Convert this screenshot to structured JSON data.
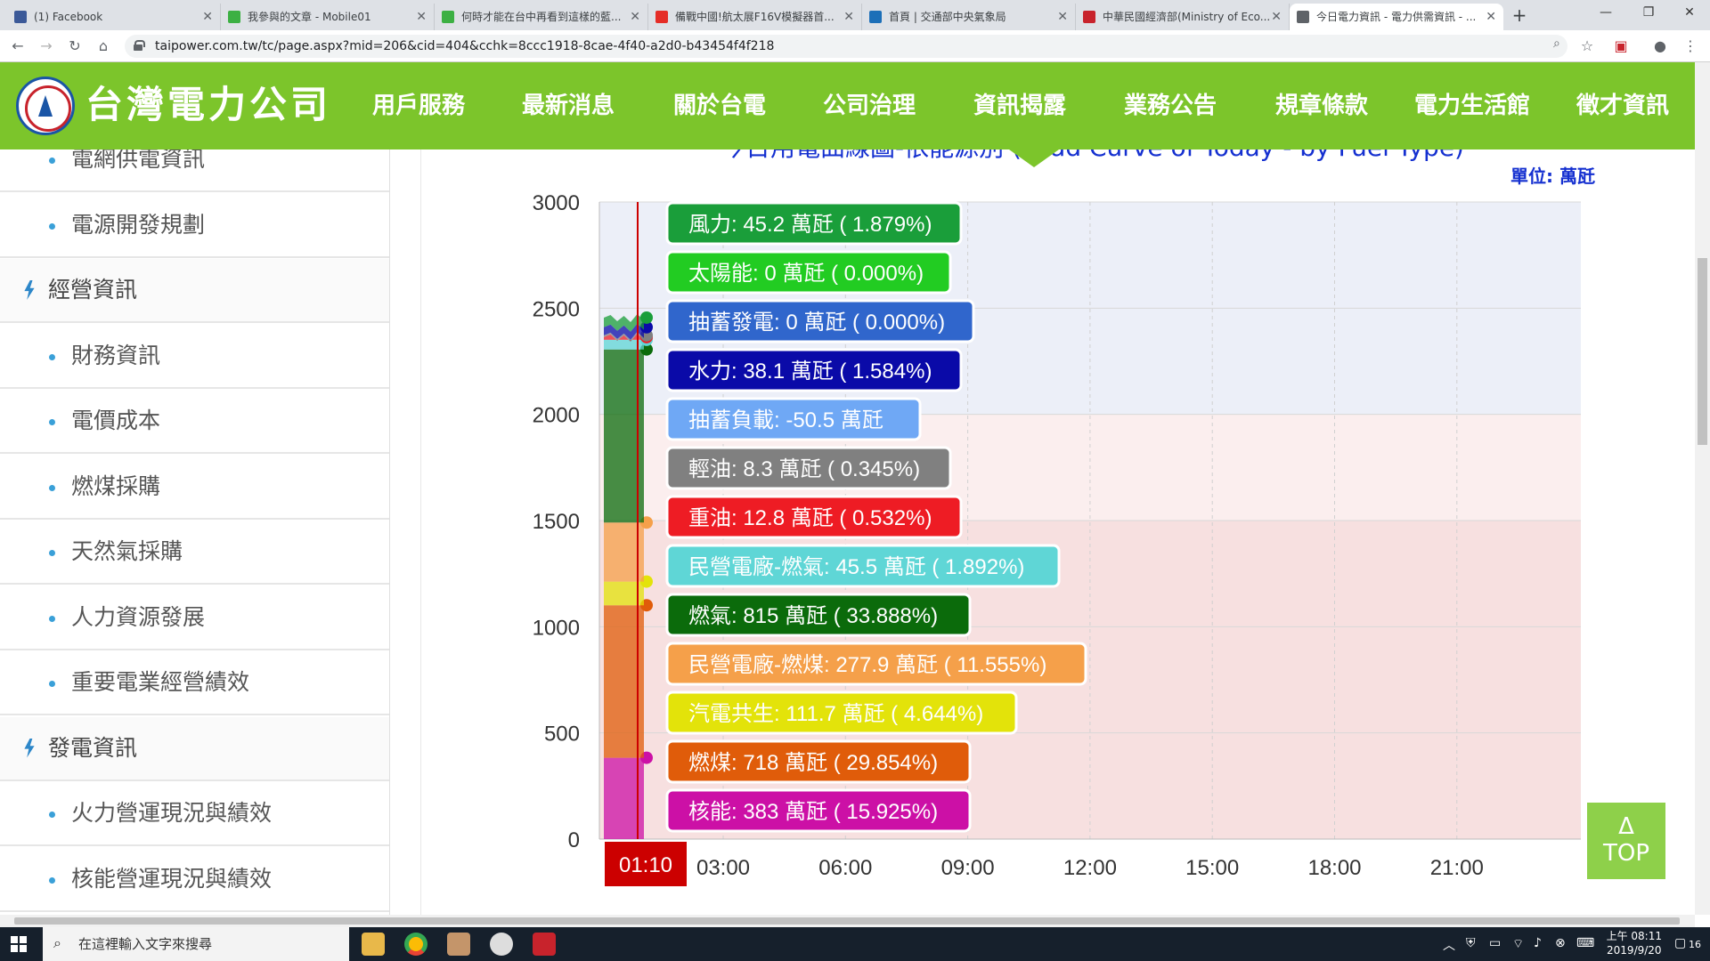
{
  "browser": {
    "tabs": [
      {
        "title": "(1) Facebook",
        "color": "#3b5998"
      },
      {
        "title": "我參與的文章 - Mobile01",
        "color": "#3cb043"
      },
      {
        "title": "何時才能在台中再看到這樣的藍...",
        "color": "#3cb043"
      },
      {
        "title": "備戰中國!航太展F16V模擬器首...",
        "color": "#e52d27"
      },
      {
        "title": "首頁 | 交通部中央氣象局",
        "color": "#1c6fb8"
      },
      {
        "title": "中華民國經濟部(Ministry of Eco...",
        "color": "#c8232c"
      },
      {
        "title": "今日電力資訊 - 電力供需資訊 - ...",
        "color": "#5f6368"
      }
    ],
    "url": "taipower.com.tw/tc/page.aspx?mid=206&cid=404&cchk=8ccc1918-8cae-4f40-a2d0-b43454f4f218"
  },
  "site": {
    "brand": "台灣電力公司",
    "nav": [
      "用戶服務",
      "最新消息",
      "關於台電",
      "公司治理",
      "資訊揭露",
      "業務公告",
      "規章條款",
      "電力生活館",
      "徵才資訊"
    ]
  },
  "sidebar": {
    "items": [
      {
        "label": "電網供電資訊",
        "type": "sub"
      },
      {
        "label": "電源開發規劃",
        "type": "sub"
      },
      {
        "label": "經營資訊",
        "type": "head"
      },
      {
        "label": "財務資訊",
        "type": "sub"
      },
      {
        "label": "電價成本",
        "type": "sub"
      },
      {
        "label": "燃煤採購",
        "type": "sub"
      },
      {
        "label": "天然氣採購",
        "type": "sub"
      },
      {
        "label": "人力資源發展",
        "type": "sub"
      },
      {
        "label": "重要電業經營績效",
        "type": "sub"
      },
      {
        "label": "發電資訊",
        "type": "head"
      },
      {
        "label": "火力營運現況與績效",
        "type": "sub"
      },
      {
        "label": "核能營運現況與績效",
        "type": "sub"
      }
    ]
  },
  "chart": {
    "title_fragment": "今日用電曲線圖-依能源別 (Load Curve of Today - by Fuel Type)",
    "unit": "單位: 萬瓩",
    "top_button": "TOP",
    "top_arrow": "Δ"
  },
  "chart_data": {
    "type": "area",
    "xlabel": "",
    "ylabel": "",
    "ylim": [
      0,
      3000
    ],
    "yticks": [
      0,
      500,
      1000,
      1500,
      2000,
      2500,
      3000
    ],
    "xticks": [
      "03:00",
      "06:00",
      "09:00",
      "12:00",
      "15:00",
      "18:00",
      "21:00"
    ],
    "cursor_time": "01:10",
    "tooltip": [
      {
        "label": "風力: 45.2 萬瓩 ( 1.879%)",
        "value": 45.2,
        "color": "#1a9e3a"
      },
      {
        "label": "太陽能: 0 萬瓩 ( 0.000%)",
        "value": 0,
        "color": "#22cc22"
      },
      {
        "label": "抽蓄發電: 0 萬瓩 ( 0.000%)",
        "value": 0,
        "color": "#3066cc"
      },
      {
        "label": "水力: 38.1 萬瓩 ( 1.584%)",
        "value": 38.1,
        "color": "#0a0aa8"
      },
      {
        "label": "抽蓄負載: -50.5 萬瓩",
        "value": -50.5,
        "color": "#6fa8f5"
      },
      {
        "label": "輕油: 8.3 萬瓩 ( 0.345%)",
        "value": 8.3,
        "color": "#808080"
      },
      {
        "label": "重油: 12.8 萬瓩 ( 0.532%)",
        "value": 12.8,
        "color": "#ee1c24"
      },
      {
        "label": "民營電廠-燃氣: 45.5 萬瓩 ( 1.892%)",
        "value": 45.5,
        "color": "#5fd6d6"
      },
      {
        "label": "燃氣: 815 萬瓩 ( 33.888%)",
        "value": 815,
        "color": "#0b6b0b"
      },
      {
        "label": "民營電廠-燃煤: 277.9 萬瓩 ( 11.555%)",
        "value": 277.9,
        "color": "#f5a04a"
      },
      {
        "label": "汽電共生: 111.7 萬瓩 ( 4.644%)",
        "value": 111.7,
        "color": "#e3e30a"
      },
      {
        "label": "燃煤: 718 萬瓩 ( 29.854%)",
        "value": 718,
        "color": "#e05c0a"
      },
      {
        "label": "核能: 383 萬瓩 ( 15.925%)",
        "value": 383,
        "color": "#cc10a6"
      }
    ],
    "bands": [
      {
        "from": 0,
        "to": 1500,
        "color": "#f7e0e0"
      },
      {
        "from": 1500,
        "to": 2000,
        "color": "#fbeeee"
      },
      {
        "from": 2000,
        "to": 3000,
        "color": "#eceff8"
      }
    ]
  },
  "taskbar": {
    "search_placeholder": "在這裡輸入文字來搜尋",
    "time": "上午 08:11",
    "date": "2019/9/20",
    "notifications": "16"
  }
}
